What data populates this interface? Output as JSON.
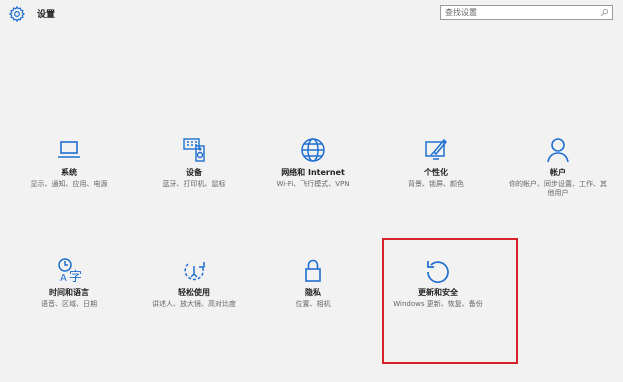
{
  "header": {
    "title": "设置",
    "search_placeholder": "查找设置",
    "gear_icon": "gear-icon",
    "search_icon": "search-icon"
  },
  "tiles": [
    {
      "name": "系统",
      "desc": "显示、通知、应用、电源",
      "icon": "laptop-icon"
    },
    {
      "name": "设备",
      "desc": "蓝牙、打印机、鼠标",
      "icon": "devices-icon"
    },
    {
      "name": "网络和 Internet",
      "desc": "Wi-Fi、飞行模式、VPN",
      "icon": "globe-icon"
    },
    {
      "name": "个性化",
      "desc": "背景、锁屏、颜色",
      "icon": "paint-icon"
    },
    {
      "name": "帐户",
      "desc": "你的帐户、同步设置、工作、其他用户",
      "icon": "person-icon"
    },
    {
      "name": "时间和语言",
      "desc": "语音、区域、日期",
      "icon": "time-language-icon"
    },
    {
      "name": "轻松使用",
      "desc": "讲述人、放大镜、高对比度",
      "icon": "ease-of-access-icon"
    },
    {
      "name": "隐私",
      "desc": "位置、相机",
      "icon": "lock-icon"
    },
    {
      "name": "更新和安全",
      "desc": "Windows 更新、恢复、备份",
      "icon": "update-icon"
    }
  ],
  "highlight_color": "#d9232a",
  "accent_color": "#1f6fd1"
}
